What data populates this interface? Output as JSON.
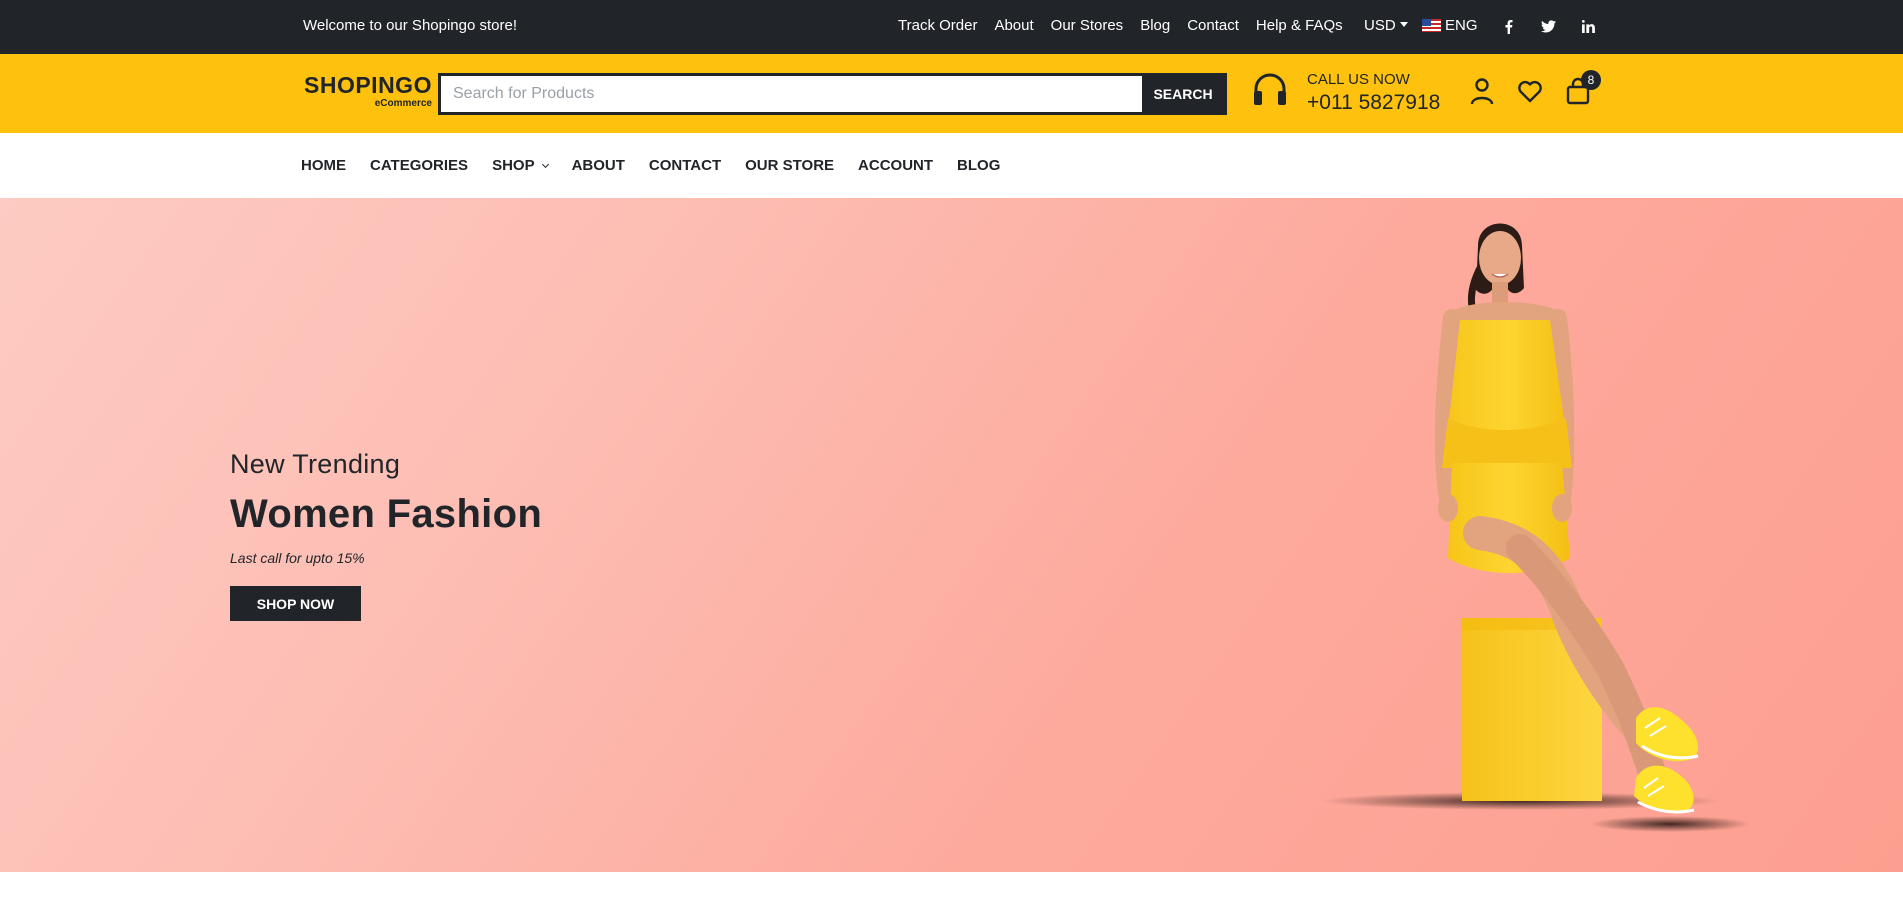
{
  "topbar": {
    "welcome": "Welcome to our Shopingo store!",
    "links": [
      "Track Order",
      "About",
      "Our Stores",
      "Blog",
      "Contact",
      "Help & FAQs"
    ],
    "currency": "USD",
    "language": "ENG",
    "social": [
      {
        "icon": "facebook-icon",
        "glyph": "f"
      },
      {
        "icon": "twitter-icon",
        "glyph": "t"
      },
      {
        "icon": "linkedin-icon",
        "glyph": "in"
      }
    ]
  },
  "header": {
    "logo_main": "SHOPINGO",
    "logo_sub": "eCommerce",
    "search_placeholder": "Search for Products",
    "search_button": "SEARCH",
    "call_label": "CALL US NOW",
    "call_phone": "+011 5827918",
    "cart_count": "8"
  },
  "nav": {
    "items": [
      "HOME",
      "CATEGORIES",
      "SHOP",
      "ABOUT",
      "CONTACT",
      "OUR STORE",
      "ACCOUNT",
      "BLOG"
    ]
  },
  "hero": {
    "eyebrow": "New Trending",
    "headline": "Women Fashion",
    "offer": "Last call for upto 15%",
    "cta": "SHOP NOW"
  },
  "colors": {
    "topbar_bg": "#212529",
    "header_bg": "#fdc10e",
    "hero_gradient_start": "#fdcbc3",
    "hero_gradient_end": "#fd9f90",
    "dress": "#fcd22a"
  }
}
